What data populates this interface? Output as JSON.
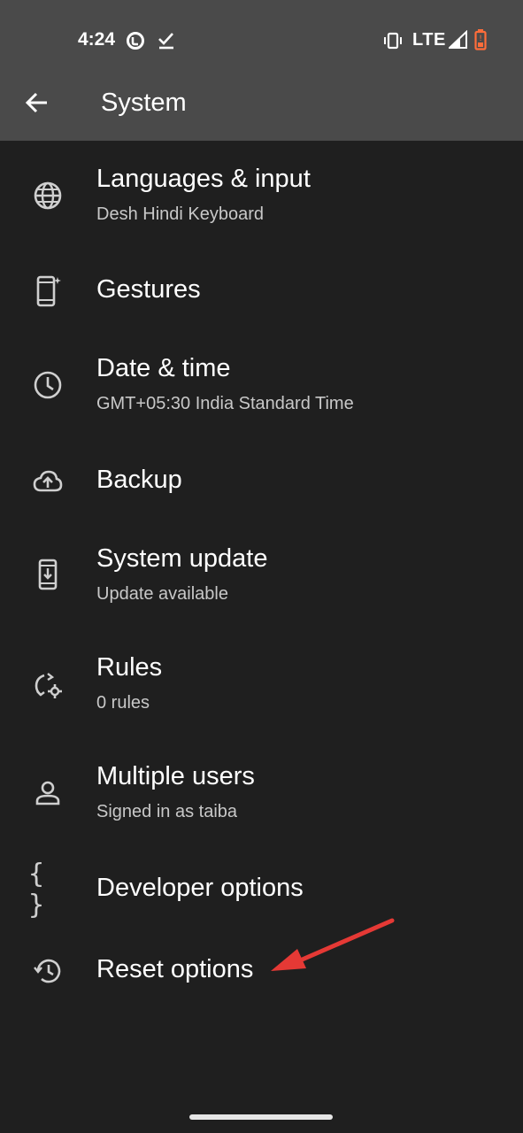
{
  "status_bar": {
    "time": "4:24",
    "network": "LTE",
    "icons": [
      "sync-icon",
      "check-icon",
      "vibrate-icon",
      "signal-icon",
      "battery-icon"
    ]
  },
  "app_bar": {
    "title": "System",
    "back_icon": "arrow-left-icon"
  },
  "items": [
    {
      "icon": "globe-icon",
      "title": "Languages & input",
      "subtitle": "Desh Hindi Keyboard"
    },
    {
      "icon": "gesture-phone-icon",
      "title": "Gestures"
    },
    {
      "icon": "clock-icon",
      "title": "Date & time",
      "subtitle": "GMT+05:30 India Standard Time"
    },
    {
      "icon": "cloud-upload-icon",
      "title": "Backup"
    },
    {
      "icon": "system-update-icon",
      "title": "System update",
      "subtitle": "Update available"
    },
    {
      "icon": "rules-icon",
      "title": "Rules",
      "subtitle": "0 rules"
    },
    {
      "icon": "person-icon",
      "title": "Multiple users",
      "subtitle": "Signed in as taiba"
    },
    {
      "icon": "braces-icon",
      "title": "Developer options"
    },
    {
      "icon": "history-icon",
      "title": "Reset options"
    }
  ],
  "colors": {
    "background": "#1f1f1f",
    "top_bar": "#4a4a4a",
    "text_primary": "#ffffff",
    "text_secondary": "#c8c8c8",
    "battery": "#ff6d3a",
    "annotation_arrow": "#e53935"
  }
}
